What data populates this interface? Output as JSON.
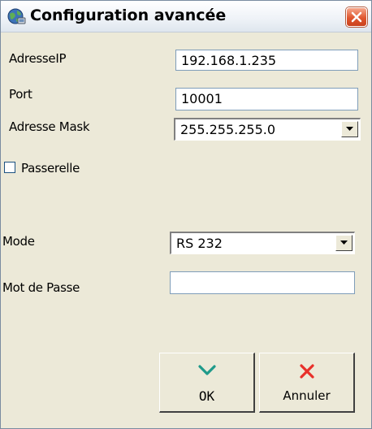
{
  "window": {
    "title": "Configuration avancée"
  },
  "form": {
    "ip_label": "AdresseIP",
    "ip_value": "192.168.1.235",
    "port_label": "Port",
    "port_value": "10001",
    "mask_label": "Adresse Mask",
    "mask_value": "255.255.255.0",
    "gateway_label": "Passerelle",
    "gateway_checked": false,
    "mode_label": "Mode",
    "mode_value": "RS 232",
    "password_label": "Mot de Passe",
    "password_value": ""
  },
  "buttons": {
    "ok_label": "OK",
    "cancel_label": "Annuler"
  },
  "icons": {
    "title": "globe-network-icon",
    "close": "close-icon",
    "ok": "checkmark-icon",
    "cancel": "cross-icon",
    "dropdown": "chevron-down-icon"
  },
  "colors": {
    "dialog_bg": "#ece9d8",
    "close_button": "#e0562e",
    "ok_icon": "#1f9a8a",
    "cancel_icon": "#e8302a"
  }
}
